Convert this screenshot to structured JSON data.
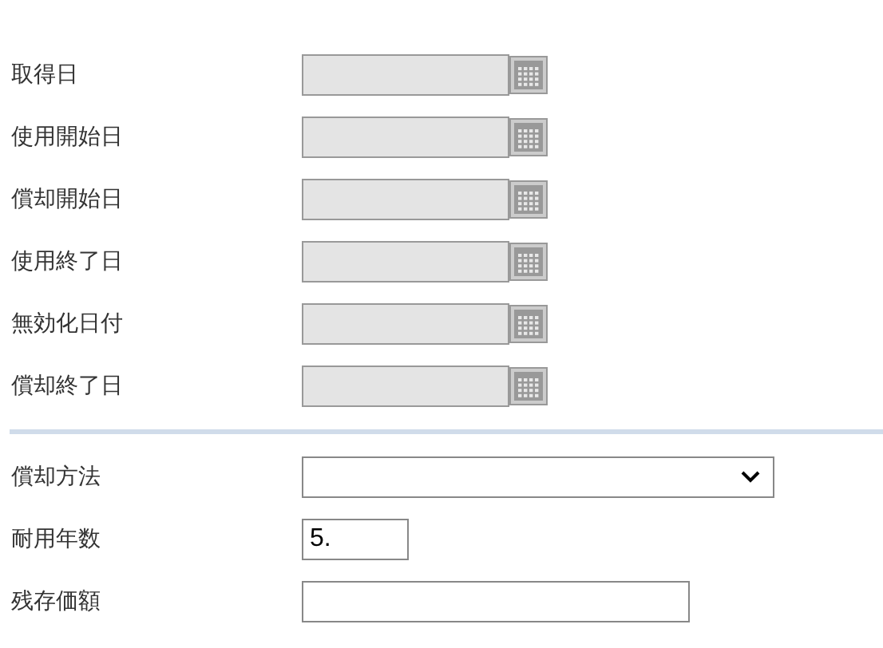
{
  "date_fields": [
    {
      "label": "取得日",
      "disabled": true
    },
    {
      "label": "使用開始日",
      "disabled": true
    },
    {
      "label": "償却開始日",
      "disabled": true
    },
    {
      "label": "使用終了日",
      "disabled": true
    },
    {
      "label": "無効化日付",
      "disabled": true
    },
    {
      "label": "償却終了日",
      "disabled": true
    }
  ],
  "fields": [
    {
      "kind": "select",
      "label": "償却方法"
    },
    {
      "kind": "number",
      "label": "耐用年数",
      "value": "5."
    },
    {
      "kind": "text",
      "label": "残存価額"
    }
  ]
}
